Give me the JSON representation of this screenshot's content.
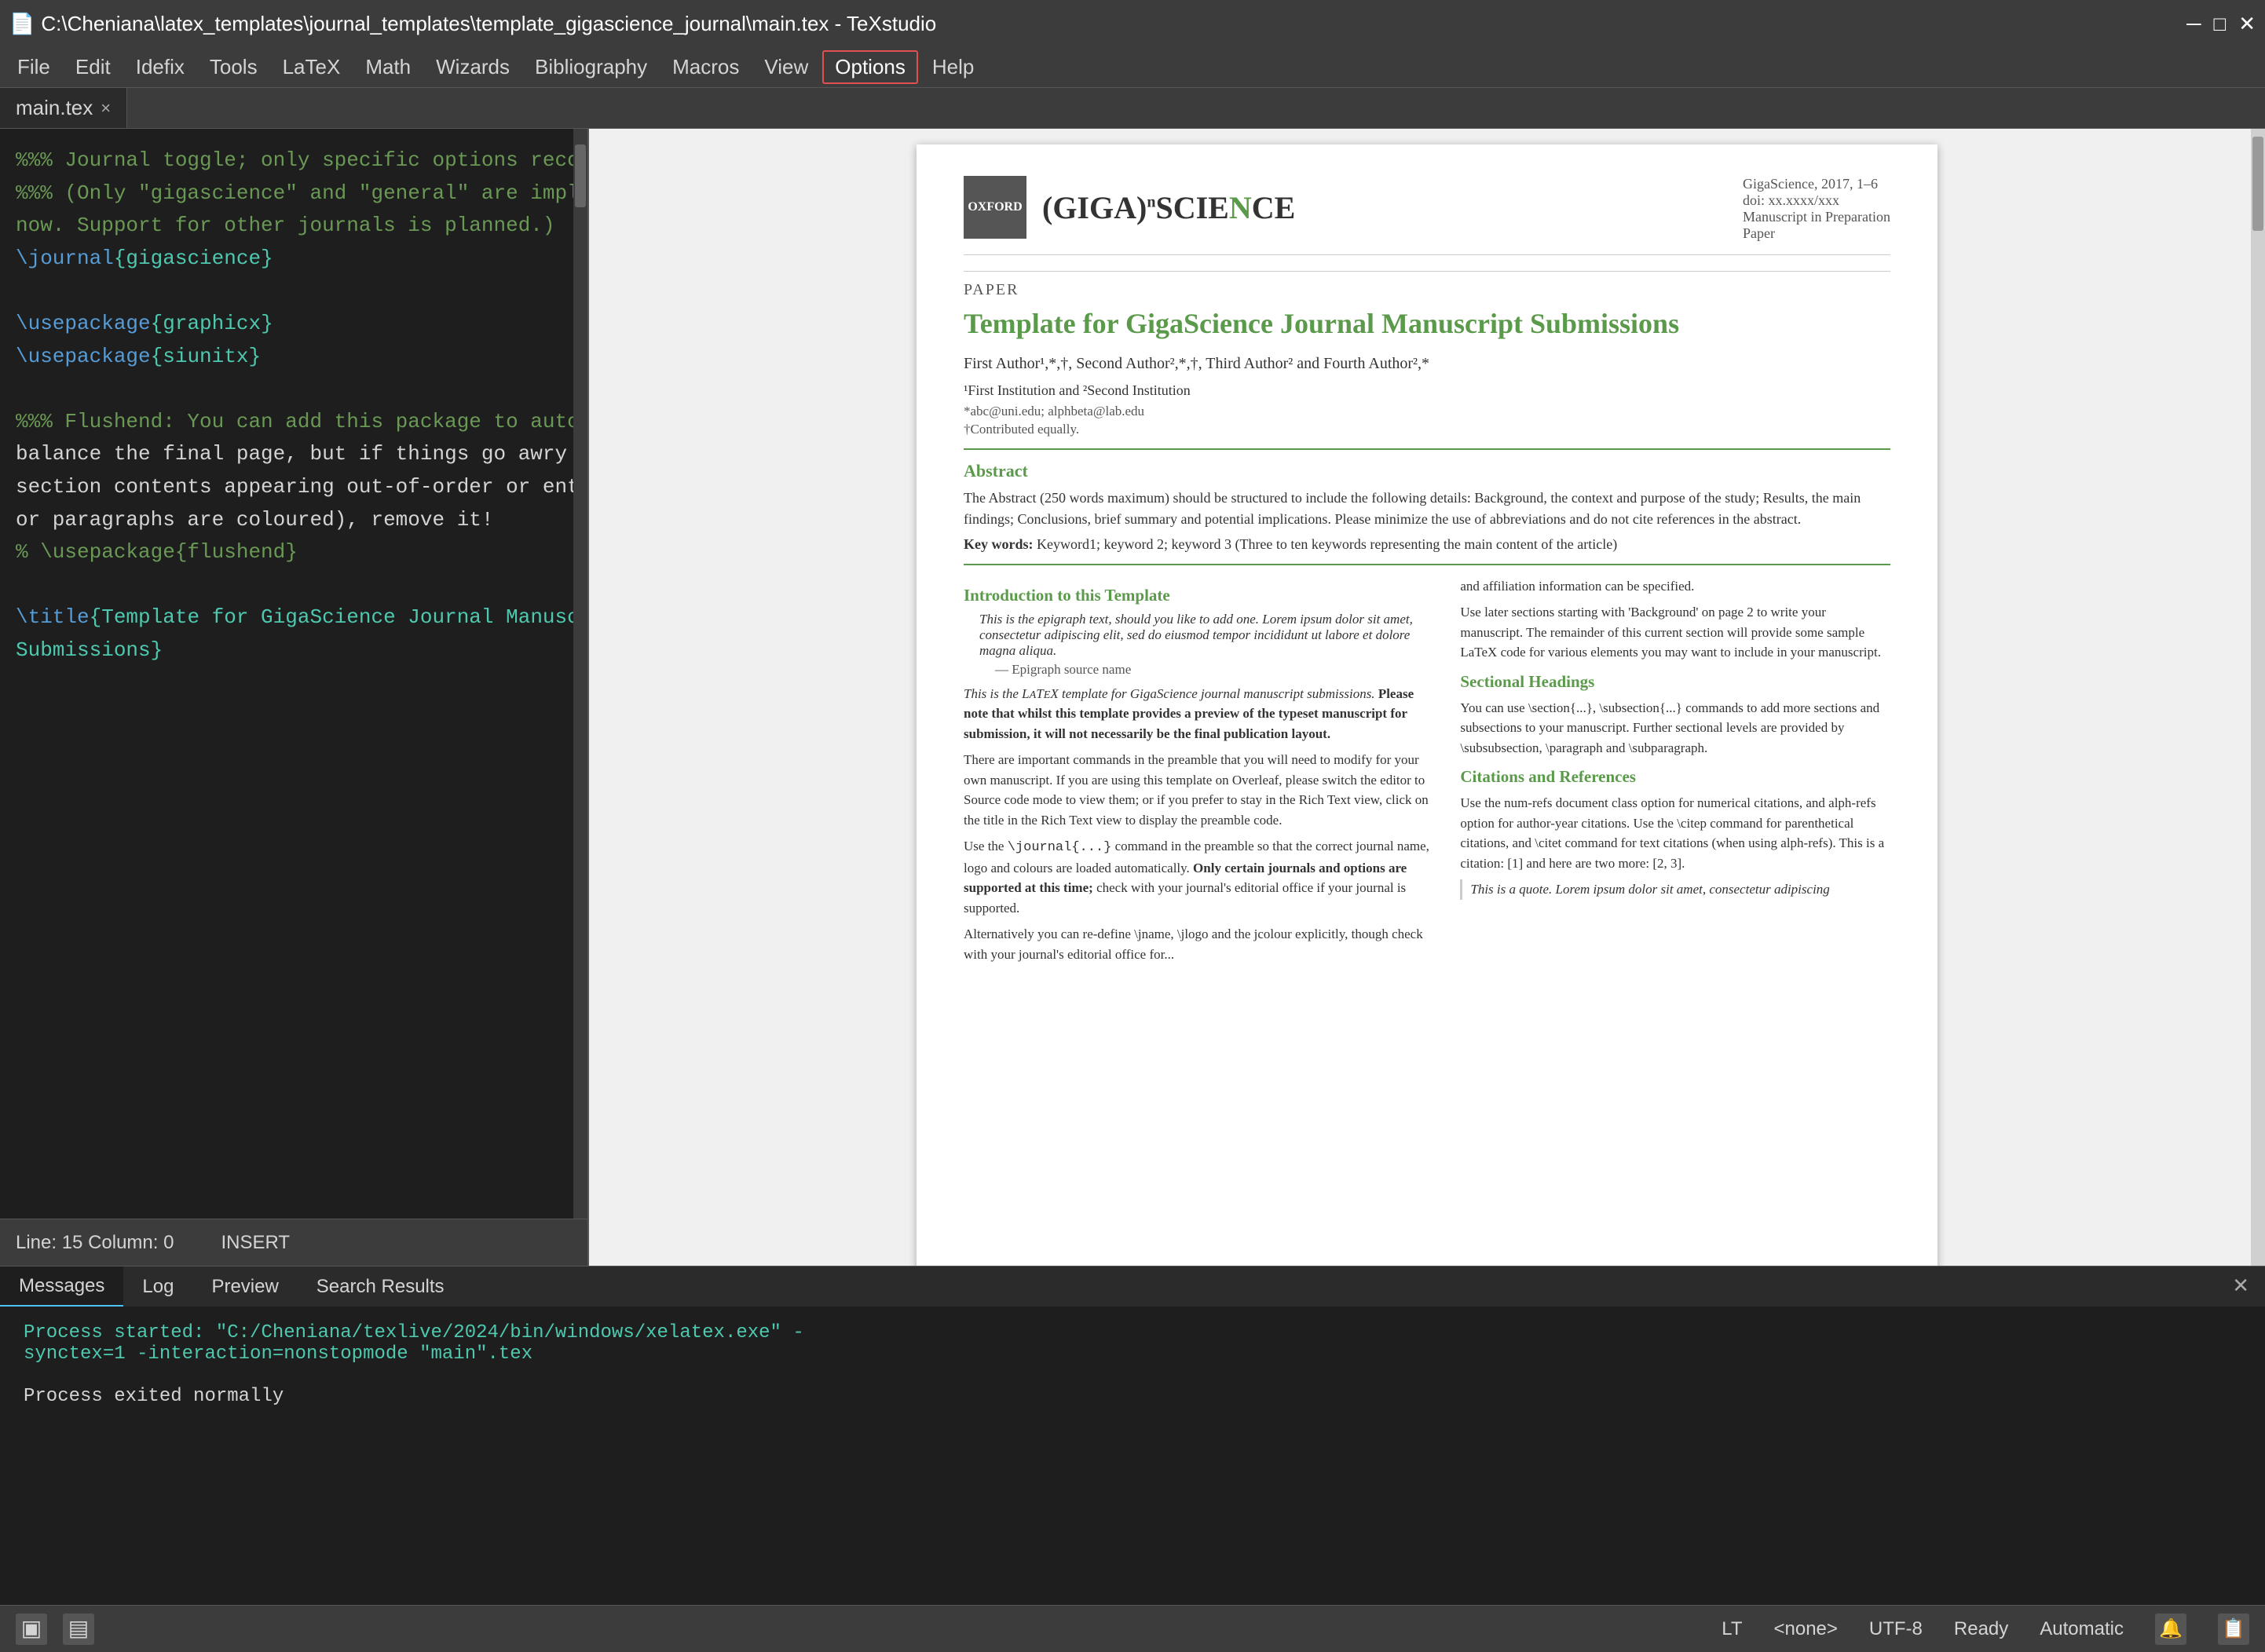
{
  "titlebar": {
    "title": "C:\\Cheniana\\latex_templates\\journal_templates\\template_gigascience_journal\\main.tex - TeXstudio",
    "icon": "📄",
    "min_btn": "─",
    "max_btn": "□",
    "close_btn": "✕"
  },
  "menubar": {
    "items": [
      "File",
      "Edit",
      "Idefix",
      "Tools",
      "LaTeX",
      "Math",
      "Wizards",
      "Bibliography",
      "Macros",
      "View",
      "Options",
      "Help"
    ],
    "highlighted": "Options"
  },
  "tabs": [
    {
      "label": "main.tex",
      "close": "×",
      "active": true
    }
  ],
  "editor": {
    "line": "Line: 15",
    "column": "Column: 0",
    "mode": "INSERT",
    "content_lines": [
      {
        "type": "comment",
        "text": "%%% Journal toggle; only specific options recognised."
      },
      {
        "type": "comment",
        "text": "%%% (Only \"gigascience\" and \"general\" are implemented"
      },
      {
        "type": "comment",
        "text": "now. Support for other journals is planned.)"
      },
      {
        "type": "command",
        "text": "\\journal{gigascience}"
      },
      {
        "type": "blank"
      },
      {
        "type": "command",
        "text": "\\usepackage{graphicx}"
      },
      {
        "type": "command",
        "text": "\\usepackage{siunitx}"
      },
      {
        "type": "blank"
      },
      {
        "type": "comment",
        "text": "%%% Flushend: You can add this package to automatically"
      },
      {
        "type": "text",
        "text": "balance the final page, but if things go awry (e.g."
      },
      {
        "type": "text",
        "text": "section contents appearing out-of-order or entire blocks"
      },
      {
        "type": "text",
        "text": "or paragraphs are coloured), remove it!"
      },
      {
        "type": "commented_cmd",
        "text": "% \\usepackage{flushend}"
      },
      {
        "type": "blank"
      },
      {
        "type": "command",
        "text": "\\title{Template for GigaScience Journal Manuscript"
      },
      {
        "type": "text",
        "text": "Submissions}"
      }
    ]
  },
  "messages_panel": {
    "tabs": [
      "Messages",
      "Log",
      "Preview",
      "Search Results"
    ],
    "active_tab": "Messages",
    "close_label": "✕",
    "log_lines": [
      {
        "type": "green",
        "text": "Process started: \"C:/Cheniana/texlive/2024/bin/windows/xelatex.exe\" -"
      },
      {
        "type": "green",
        "text": "synctex=1 -interaction=nonstopmode \"main\".tex"
      },
      {
        "type": "blank"
      },
      {
        "type": "white",
        "text": "Process exited normally"
      }
    ]
  },
  "preview": {
    "journal_year": "GigaScience, 2017, 1–6",
    "doi": "doi: xx.xxxx/xxx",
    "manuscript_type": "Manuscript in Preparation",
    "paper_type": "Paper",
    "section_label": "PAPER",
    "article_title": "Template for GigaScience Journal Manuscript Submissions",
    "authors": "First Author¹,*,†, Second Author²,*,†, Third Author² and Fourth Author²,*",
    "affiliation": "¹First Institution and ²Second Institution",
    "email": "*abc@uni.edu; alphbeta@lab.edu",
    "contributed": "†Contributed equally.",
    "abstract_title": "Abstract",
    "abstract_text": "The Abstract (250 words maximum) should be structured to include the following details: Background, the context and purpose of the study; Results, the main findings; Conclusions, brief summary and potential implications. Please minimize the use of abbreviations and do not cite references in the abstract.",
    "keywords_label": "Key words:",
    "keywords": "Keyword1; keyword 2; keyword 3 (Three to ten keywords representing the main content of the article)",
    "intro_title": "Introduction to this Template",
    "epigraph": "This is the epigraph text, should you like to add one. Lorem ipsum dolor sit amet, consectetur adipiscing elit, sed do eiusmod tempor incididunt ut labore et dolore magna aliqua.",
    "epigraph_source": "— Epigraph source name",
    "intro_body_1": "This is the LaTeX template for GigaScience journal manuscript submissions. Please note that whilst this template provides a preview of the typeset manuscript for submission, it will not necessarily be the final publication layout.",
    "intro_body_2": "There are important commands in the preamble that you will need to modify for your own manuscript. If you are using this template on Overleaf, please switch the editor to Source code mode to view them; or if you prefer to stay in the Rich Text view, click on the title in the Rich Text view to display the preamble code.",
    "intro_body_3": "Use the \\journal{...} command in the preamble so that the correct journal name, logo and colours are loaded automatically. Only certain journals and options are supported at this time; check with your journal's editorial office if your journal is supported.",
    "intro_body_4": "Alternatively you can re-define \\jname, \\jlogo and the jcolour explicitly, though check with your journal's editorial office for...",
    "right_col_body_1": "and affiliation information can be specified.",
    "right_col_body_2": "Use later sections starting with 'Background' on page 2 to write your manuscript. The remainder of this current section will provide some sample LaTeX code for various elements you may want to include in your manuscript.",
    "sectional_title": "Sectional Headings",
    "sectional_body": "You can use \\section{...}, \\subsection{...} commands to add more sections and subsections to your manuscript. Further sectional levels are provided by \\subsubsection, \\paragraph and \\subparagraph.",
    "citations_title": "Citations and References",
    "citations_body": "Use the num-refs document class option for numerical citations, and alph-refs option for author-year citations. Use the \\citep command for parenthetical citations, and \\citet command for text citations (when using alph-refs). This is a citation: [1] and here are two more: [2, 3].",
    "quote_text": "This is a quote. Lorem ipsum dolor sit amet, consectetur adipiscing"
  },
  "statusbar": {
    "line_col": "Line: 15    Column: 0",
    "mode": "INSERT",
    "lt_label": "LT",
    "encoding_selector": "<none>",
    "charset": "UTF-8",
    "status": "Ready",
    "spell_check": "Automatic"
  },
  "bottom_icons": {
    "icon1": "▣",
    "icon2": "▤",
    "icon3": "🔔",
    "icon4": "📋"
  }
}
